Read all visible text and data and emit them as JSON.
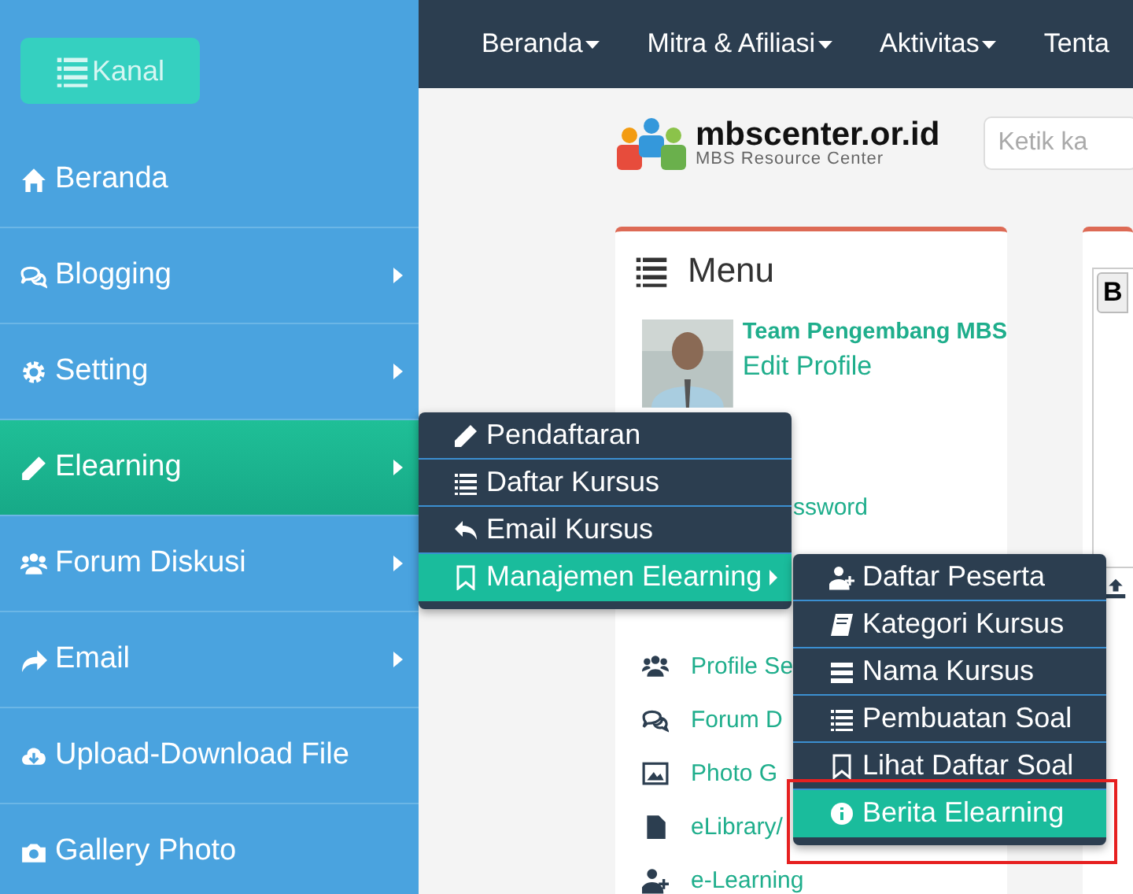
{
  "sidebar": {
    "button": "Kanal",
    "items": [
      {
        "label": "Beranda",
        "has_submenu": false,
        "selected": false
      },
      {
        "label": "Blogging",
        "has_submenu": true,
        "selected": false
      },
      {
        "label": "Setting",
        "has_submenu": true,
        "selected": false
      },
      {
        "label": "Elearning",
        "has_submenu": true,
        "selected": true
      },
      {
        "label": "Forum Diskusi",
        "has_submenu": true,
        "selected": false
      },
      {
        "label": "Email",
        "has_submenu": true,
        "selected": false
      },
      {
        "label": "Upload-Download File",
        "has_submenu": false,
        "selected": false
      },
      {
        "label": "Gallery Photo",
        "has_submenu": false,
        "selected": false
      }
    ]
  },
  "topnav": [
    {
      "label": "Beranda",
      "has_caret": true
    },
    {
      "label": "Mitra & Afiliasi",
      "has_caret": true
    },
    {
      "label": "Aktivitas",
      "has_caret": true
    },
    {
      "label": "Tenta",
      "has_caret": false
    }
  ],
  "logo": {
    "name": "mbscenter.or.id",
    "tagline": "MBS Resource Center"
  },
  "search": {
    "placeholder": "Ketik ka"
  },
  "menu_card": {
    "title": "Menu",
    "profile": {
      "name": "Team Pengembang MBS",
      "link": "Edit Profile"
    },
    "items": [
      "ssword",
      "Profile Se",
      "Forum D",
      "Photo G",
      "eLibrary/",
      "e-Learning"
    ]
  },
  "right_card": {
    "button": "B"
  },
  "submenu": [
    {
      "label": "Pendaftaran",
      "selected": false,
      "has_submenu": false
    },
    {
      "label": "Daftar Kursus",
      "selected": false,
      "has_submenu": false
    },
    {
      "label": "Email Kursus",
      "selected": false,
      "has_submenu": false
    },
    {
      "label": "Manajemen Elearning",
      "selected": true,
      "has_submenu": true
    }
  ],
  "submenu2": [
    {
      "label": "Daftar Peserta",
      "selected": false
    },
    {
      "label": "Kategori Kursus",
      "selected": false
    },
    {
      "label": "Nama Kursus",
      "selected": false
    },
    {
      "label": "Pembuatan Soal",
      "selected": false
    },
    {
      "label": "Lihat Daftar Soal",
      "selected": false
    },
    {
      "label": "Berita Elearning",
      "selected": true
    }
  ],
  "highlight": {
    "shown": true
  }
}
